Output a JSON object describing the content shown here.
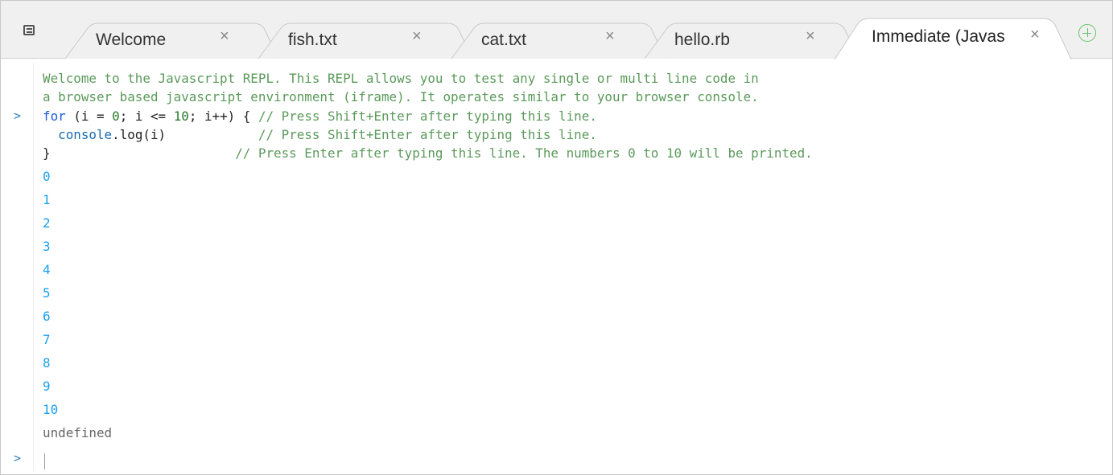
{
  "tabs": [
    {
      "label": "Welcome",
      "close": "×"
    },
    {
      "label": "fish.txt",
      "close": "×"
    },
    {
      "label": "cat.txt",
      "close": "×"
    },
    {
      "label": "hello.rb",
      "close": "×"
    },
    {
      "label": "Immediate (Javas",
      "close": "×",
      "active": true
    }
  ],
  "toolbar": {
    "menu_icon": "menu-icon",
    "add_tab_icon": "add-tab-icon"
  },
  "repl": {
    "welcome_line1": "Welcome to the Javascript REPL. This REPL allows you to test any single or multi line code in",
    "welcome_line2": "a browser based javascript environment (iframe). It operates similar to your browser console.",
    "prompt_symbol": ">",
    "code": {
      "line1": {
        "kw": "for",
        "open": " (",
        "var1": "i",
        "eq": " = ",
        "zero": "0",
        "mid1": "; i <= ",
        "ten": "10",
        "mid2": "; i++) { ",
        "comment": "// Press Shift+Enter after typing this line."
      },
      "line2": {
        "indent": "  ",
        "obj": "console",
        "call": ".log(i)",
        "pad": "            ",
        "comment": "// Press Shift+Enter after typing this line."
      },
      "line3": {
        "brace": "}",
        "pad": "                        ",
        "comment": "// Press Enter after typing this line. The numbers 0 to 10 will be printed."
      }
    },
    "outputs": [
      "0",
      "1",
      "2",
      "3",
      "4",
      "5",
      "6",
      "7",
      "8",
      "9",
      "10"
    ],
    "return_value": "undefined",
    "input_value": ""
  },
  "colors": {
    "tab_bar": "#f0f0f0",
    "prompt": "#2f7fb8",
    "output": "#1aa0f0",
    "comment": "#5c9a5c",
    "add_tab": "#6ac36a"
  }
}
